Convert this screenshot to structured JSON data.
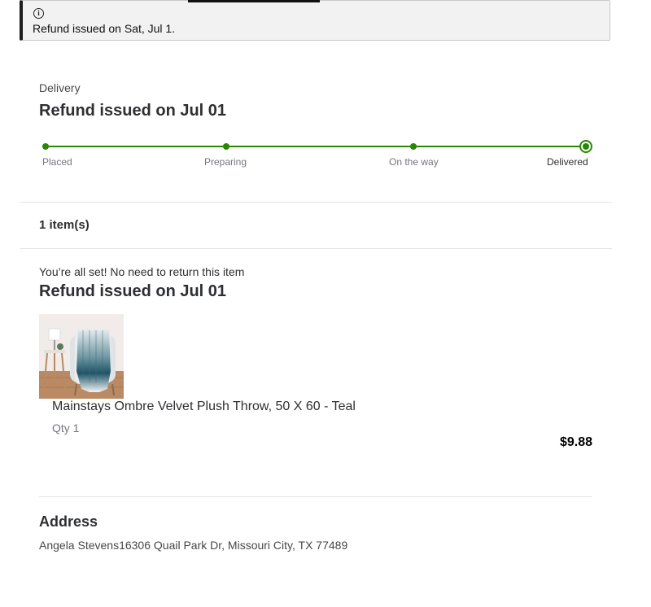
{
  "banner": {
    "icon": "info-icon",
    "message": "Refund issued on Sat, Jul 1."
  },
  "delivery": {
    "label": "Delivery",
    "title": "Refund issued on Jul 01",
    "progress_fraction": 1.0,
    "steps": [
      {
        "label": "Placed"
      },
      {
        "label": "Preparing"
      },
      {
        "label": "On the way"
      },
      {
        "label": "Delivered"
      }
    ],
    "accent_color": "#2a8703"
  },
  "items": {
    "count_label": "1 item(s)",
    "note": "You’re all set! No need to return this item",
    "status_title": "Refund issued on Jul 01",
    "list": [
      {
        "name": "Mainstays Ombre Velvet Plush Throw, 50 X 60 - Teal",
        "qty": "Qty 1",
        "price": "$9.88",
        "image": "teal-ombre-throw-on-chair"
      }
    ]
  },
  "address": {
    "title": "Address",
    "text": "Angela Stevens16306 Quail Park Dr, Missouri City, TX 77489"
  }
}
